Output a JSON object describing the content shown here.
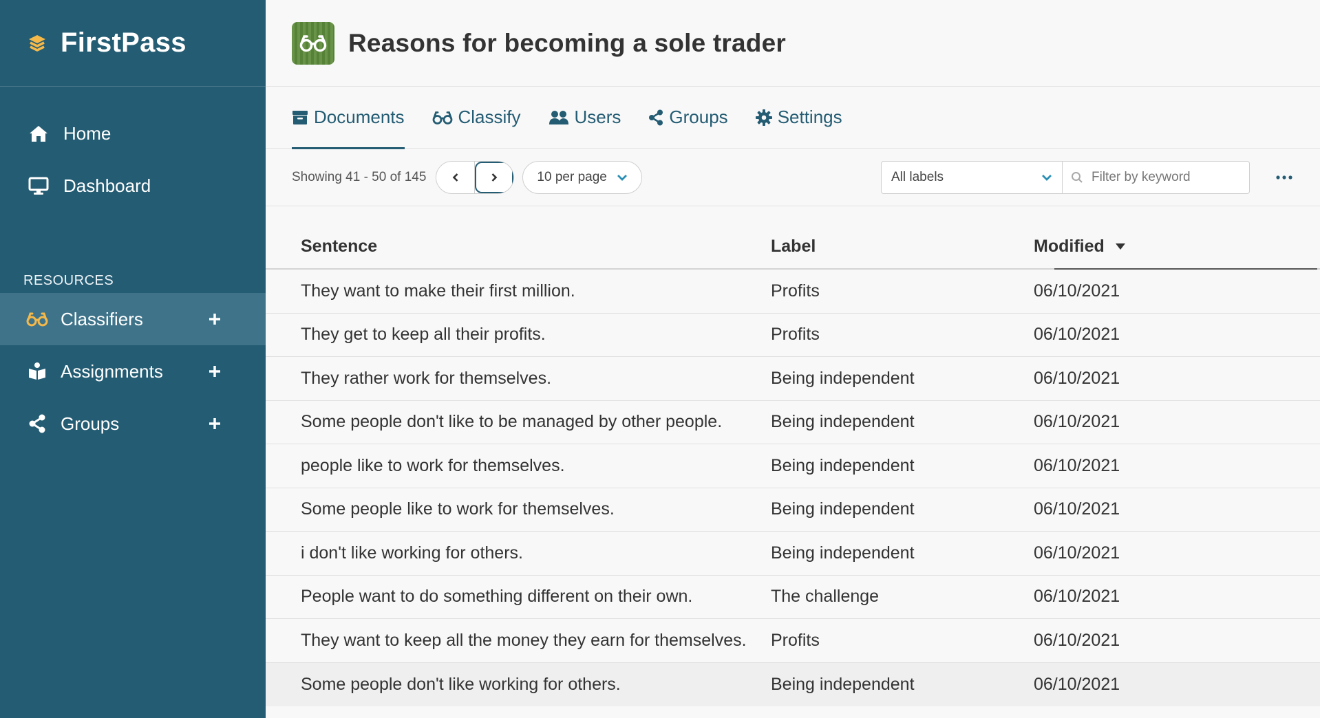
{
  "sidebar": {
    "brand": "FirstPass",
    "nav": [
      {
        "label": "Home",
        "icon": "home-icon"
      },
      {
        "label": "Dashboard",
        "icon": "monitor-icon"
      }
    ],
    "resources_title": "RESOURCES",
    "resources": [
      {
        "label": "Classifiers",
        "icon": "glasses-icon",
        "active": true
      },
      {
        "label": "Assignments",
        "icon": "reader-icon",
        "active": false
      },
      {
        "label": "Groups",
        "icon": "share-icon",
        "active": false
      }
    ]
  },
  "header": {
    "title": "Reasons for becoming a sole trader"
  },
  "tabs": [
    {
      "label": "Documents",
      "icon": "archive-icon",
      "active": true
    },
    {
      "label": "Classify",
      "icon": "glasses-icon",
      "active": false
    },
    {
      "label": "Users",
      "icon": "users-icon",
      "active": false
    },
    {
      "label": "Groups",
      "icon": "share-icon",
      "active": false
    },
    {
      "label": "Settings",
      "icon": "gear-icon",
      "active": false
    }
  ],
  "toolbar": {
    "showing": "Showing 41 - 50 of 145",
    "per_page": "10 per page",
    "labels_filter": "All labels",
    "keyword_placeholder": "Filter by keyword"
  },
  "table": {
    "headers": {
      "sentence": "Sentence",
      "label": "Label",
      "modified": "Modified"
    },
    "rows": [
      {
        "sentence": "They want to make their first million.",
        "label": "Profits",
        "modified": "06/10/2021"
      },
      {
        "sentence": "They get to keep all their profits.",
        "label": "Profits",
        "modified": "06/10/2021"
      },
      {
        "sentence": "They rather work for themselves.",
        "label": "Being independent",
        "modified": "06/10/2021"
      },
      {
        "sentence": "Some people don't like to be managed by other people.",
        "label": "Being independent",
        "modified": "06/10/2021"
      },
      {
        "sentence": "people like to work for themselves.",
        "label": "Being independent",
        "modified": "06/10/2021"
      },
      {
        "sentence": "Some people like to work for themselves.",
        "label": "Being independent",
        "modified": "06/10/2021"
      },
      {
        "sentence": "i don't like working for others.",
        "label": "Being independent",
        "modified": "06/10/2021"
      },
      {
        "sentence": "People want to do something different on their own.",
        "label": "The challenge",
        "modified": "06/10/2021"
      },
      {
        "sentence": "They want to keep all the money they earn for themselves.",
        "label": "Profits",
        "modified": "06/10/2021"
      },
      {
        "sentence": "Some people don't like working for others.",
        "label": "Being independent",
        "modified": "06/10/2021"
      }
    ]
  },
  "colors": {
    "sidebar_bg": "#245c73",
    "sidebar_active": "#3e7389",
    "accent": "#245c73",
    "brand_icon": "#f5b94a"
  }
}
